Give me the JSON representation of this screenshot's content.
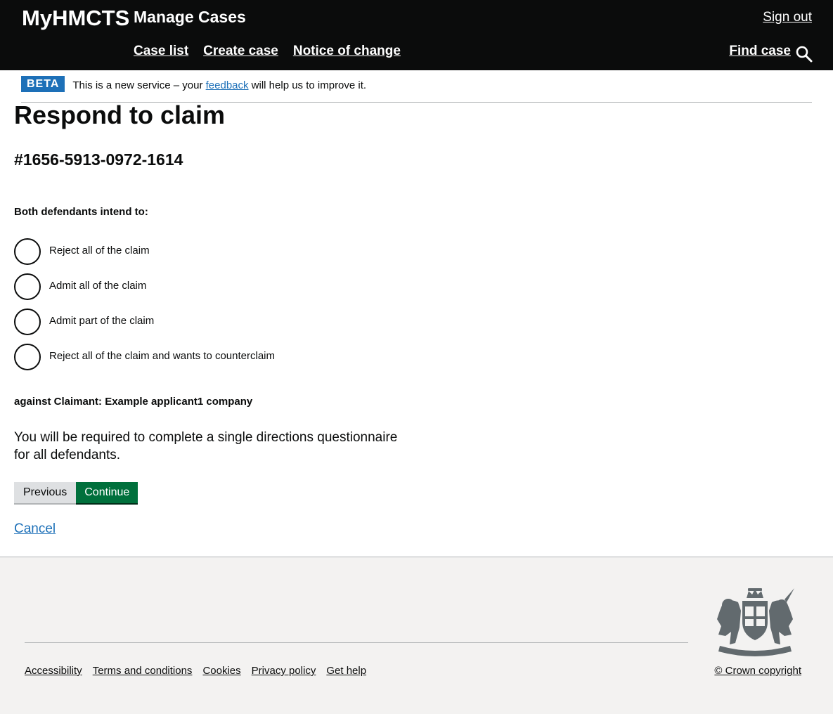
{
  "header": {
    "brand": "MyHMCTS",
    "service_name": "Manage Cases",
    "sign_out": "Sign out",
    "nav": [
      "Case list",
      "Create case",
      "Notice of change"
    ],
    "find_case": "Find case",
    "search_icon": "search-icon"
  },
  "banner": {
    "tag": "BETA",
    "text_before": "This is a new service – your ",
    "link": "feedback",
    "text_after": " will help us to improve it."
  },
  "main": {
    "title": "Respond to claim",
    "case_id": "#1656-5913-0972-1614",
    "question": "Both defendants intend to:",
    "options": [
      "Reject all of the claim",
      "Admit all of the claim",
      "Admit part of the claim",
      "Reject all of the claim and wants to counterclaim"
    ],
    "against": "against Claimant: Example applicant1 company",
    "questionnaire_note": "You will be required to complete a single directions questionnaire for all defendants.",
    "previous_button": "Previous",
    "continue_button": "Continue",
    "cancel_link": "Cancel"
  },
  "footer": {
    "links": [
      "Accessibility",
      "Terms and conditions",
      "Cookies",
      "Privacy policy",
      "Get help"
    ],
    "copyright": "© Crown copyright",
    "crest_icon": "royal-coat-of-arms-icon"
  },
  "colors": {
    "header_bg": "#0b0c0c",
    "beta_tag": "#1d70b8",
    "link": "#1d70b8",
    "continue_button": "#00703c",
    "previous_button": "#dee0e2",
    "footer_bg": "#f3f2f1"
  }
}
